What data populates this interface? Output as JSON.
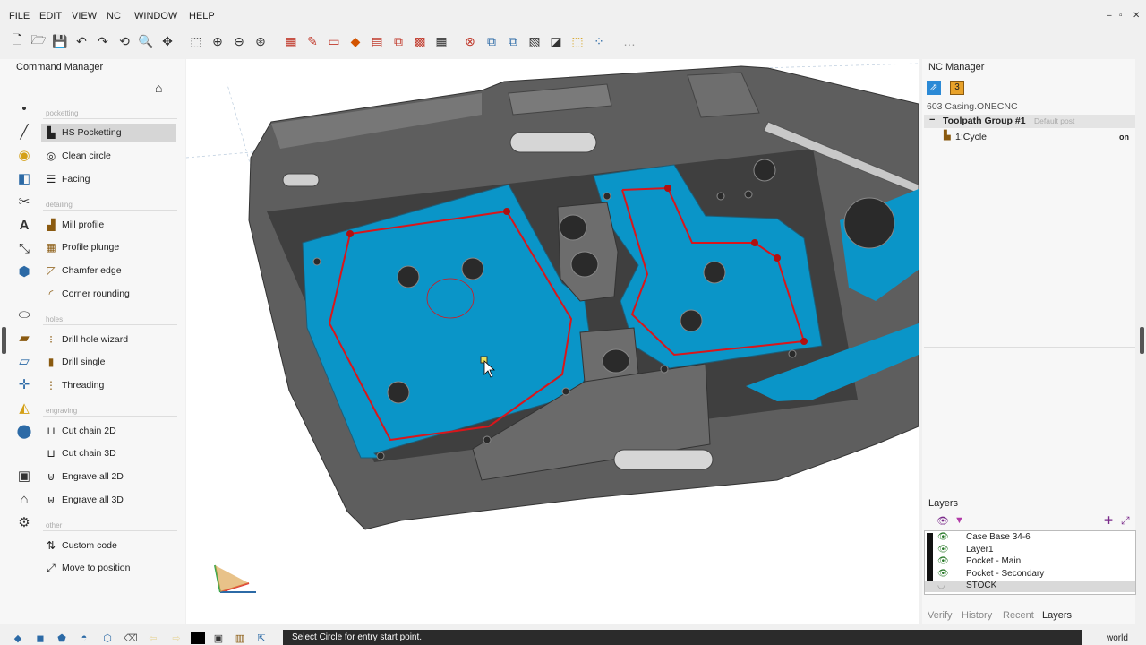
{
  "menu": [
    "FILE",
    "EDIT",
    "VIEW",
    "NC",
    "WINDOW",
    "HELP"
  ],
  "window_controls": [
    "–",
    "▫",
    "✕"
  ],
  "command_manager": {
    "title": "Command Manager",
    "categories": [
      "pocketting",
      "detailing",
      "holes",
      "engraving",
      "other"
    ],
    "items": [
      {
        "label": "HS Pocketting",
        "icon": "hs-pocket-icon",
        "selected": true
      },
      {
        "label": "Clean circle",
        "icon": "clean-circle-icon"
      },
      {
        "label": "Facing",
        "icon": "facing-icon"
      },
      {
        "label": "Mill profile",
        "icon": "mill-profile-icon"
      },
      {
        "label": "Profile plunge",
        "icon": "profile-plunge-icon"
      },
      {
        "label": "Chamfer edge",
        "icon": "chamfer-edge-icon"
      },
      {
        "label": "Corner rounding",
        "icon": "corner-rounding-icon"
      },
      {
        "label": "Drill hole wizard",
        "icon": "drill-wizard-icon"
      },
      {
        "label": "Drill single",
        "icon": "drill-single-icon"
      },
      {
        "label": "Threading",
        "icon": "threading-icon"
      },
      {
        "label": "Cut chain 2D",
        "icon": "cut-chain-2d-icon"
      },
      {
        "label": "Cut chain 3D",
        "icon": "cut-chain-3d-icon"
      },
      {
        "label": "Engrave all 2D",
        "icon": "engrave-2d-icon"
      },
      {
        "label": "Engrave all 3D",
        "icon": "engrave-3d-icon"
      },
      {
        "label": "Custom code",
        "icon": "custom-code-icon"
      },
      {
        "label": "Move to position",
        "icon": "move-position-icon"
      }
    ]
  },
  "nc_manager": {
    "title": "NC Manager",
    "badge": "3",
    "file": "603 Casing.ONECNC",
    "group": "Toolpath Group #1",
    "post": "Default post",
    "cycle": "1:Cycle",
    "cycle_state": "on"
  },
  "layers": {
    "title": "Layers",
    "items": [
      {
        "name": "Case Base 34-6",
        "visible": true
      },
      {
        "name": "Layer1",
        "visible": true
      },
      {
        "name": "Pocket - Main",
        "visible": true
      },
      {
        "name": "Pocket - Secondary",
        "visible": true
      },
      {
        "name": "STOCK",
        "visible": false,
        "selected": true
      }
    ]
  },
  "right_tabs": [
    "Verify",
    "History",
    "Recent",
    "Layers"
  ],
  "active_right_tab": "Layers",
  "status": {
    "message": "Select Circle for entry start point.",
    "coord_system": "world"
  },
  "colors": {
    "pocket_fill": "#0a95c8",
    "toolpath": "#d8161b",
    "part_gray": "#6a6a6a",
    "selected_row": "#d6d6d6"
  }
}
